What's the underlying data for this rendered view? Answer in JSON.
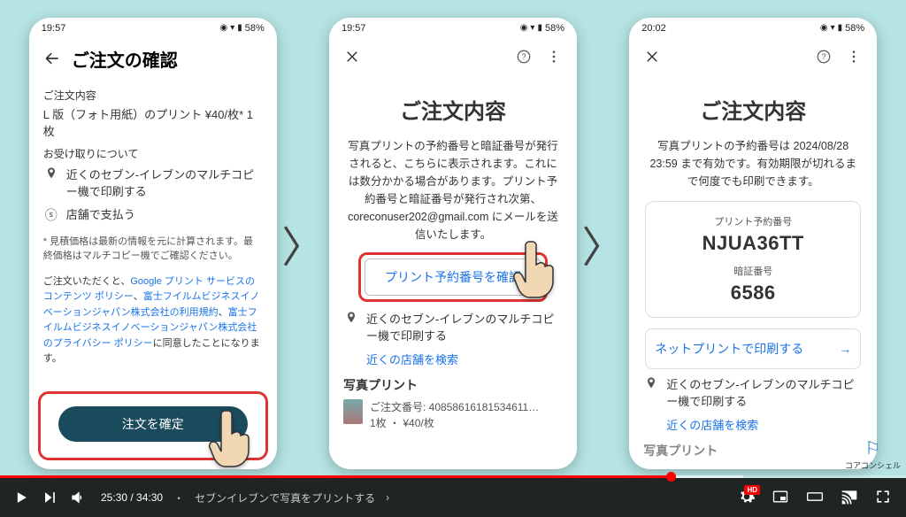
{
  "status": {
    "time1": "19:57",
    "time2": "19:57",
    "time3": "20:02",
    "batt": "58%",
    "icons": "◎ ▾ ▮"
  },
  "p1": {
    "title": "ご注文の確認",
    "sec1_label": "ご注文内容",
    "item_line": "L 版（フォト用紙）のプリント  ¥40/枚* 1枚",
    "sec2_label": "お受け取りについて",
    "pickup": "近くのセブン-イレブンのマルチコピー機で印刷する",
    "pay": "店舗で支払う",
    "disclaimer": "* 見積価格は最新の情報を元に計算されます。最終価格はマルチコピー機でご確認ください。",
    "legal_pre": "ご注文いただくと、",
    "legal_link1": "Google プリント サービスのコンテンツ ポリシー",
    "legal_sep1": "、",
    "legal_link2": "富士フイルムビジネスイノベーションジャパン株式会社の利用規約",
    "legal_sep2": "、",
    "legal_link3": "富士フイルムビジネスイノベーションジャパン株式会社のプライバシー ポリシー",
    "legal_post": "に同意したことになります。",
    "confirm": "注文を確定"
  },
  "p2": {
    "title": "ご注文内容",
    "desc": "写真プリントの予約番号と暗証番号が発行されると、こちらに表示されます。これには数分かかる場合があります。プリント予約番号と暗証番号が発行され次第、coreconuser202@gmail.com にメールを送信いたします。",
    "check_btn": "プリント予約番号を確認",
    "pickup": "近くのセブン-イレブンのマルチコピー機で印刷する",
    "search_link": "近くの店舗を検索",
    "photo_h": "写真プリント",
    "order_no": "ご注文番号: 40858616181534611…",
    "qty_price": "1枚 ・ ¥40/枚"
  },
  "p3": {
    "title": "ご注文内容",
    "desc": "写真プリントの予約番号は 2024/08/28 23:59 まで有効です。有効期限が切れるまで何度でも印刷できます。",
    "reserve_label": "プリント予約番号",
    "reserve_val": "NJUA36TT",
    "pin_label": "暗証番号",
    "pin_val": "6586",
    "net_btn": "ネットプリントで印刷する",
    "pickup": "近くのセブン-イレブンのマルチコピー機で印刷する",
    "search_link": "近くの店舗を検索",
    "photo_h": "写真プリント"
  },
  "arrow": "〉",
  "video": {
    "time": "25:30 / 34:30",
    "chapter": "セブンイレブンで写真をプリントする",
    "hd": "HD"
  },
  "corner_logo": "コアコンシェル"
}
